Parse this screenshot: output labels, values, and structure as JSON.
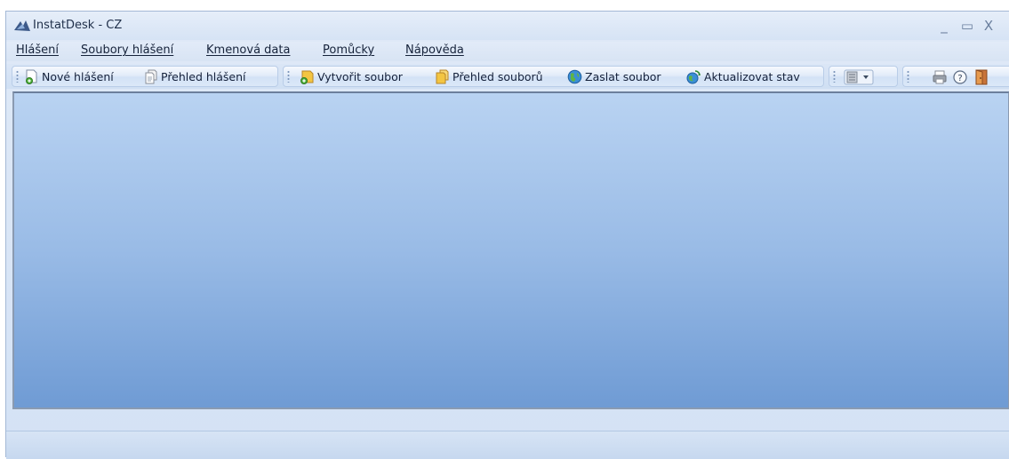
{
  "window": {
    "title": "InstatDesk - CZ",
    "controls": {
      "minimize": "_",
      "maximize": "▭",
      "close": "X"
    }
  },
  "menu": {
    "items": [
      {
        "label": "Hlášení"
      },
      {
        "label": "Soubory hlášení"
      },
      {
        "label": "Kmenová data"
      },
      {
        "label": "Pomůcky"
      },
      {
        "label": "Nápověda"
      }
    ]
  },
  "toolbar": {
    "reports": [
      {
        "label": "Nové hlášení",
        "icon": "new-report-icon"
      },
      {
        "label": "Přehled hlášení",
        "icon": "report-overview-icon"
      }
    ],
    "files": [
      {
        "label": "Vytvořit soubor",
        "icon": "create-file-icon"
      },
      {
        "label": "Přehled souborů",
        "icon": "files-overview-icon"
      },
      {
        "label": "Zaslat soubor",
        "icon": "globe-icon"
      },
      {
        "label": "Aktualizovat stav",
        "icon": "refresh-status-icon"
      }
    ],
    "view_icon": "view-layout-icon",
    "tools": [
      "printer-icon",
      "help-icon",
      "exit-door-icon"
    ]
  },
  "colors": {
    "client_top": "#b9d3f2",
    "client_bottom": "#6f9bd4",
    "chrome": "#d4e2f5"
  }
}
